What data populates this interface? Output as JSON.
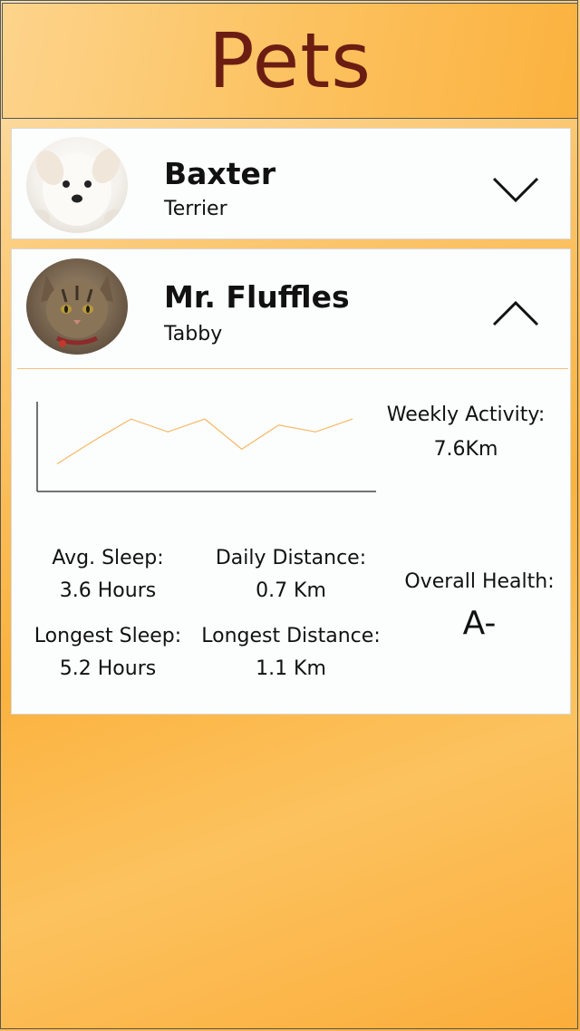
{
  "header": {
    "title": "Pets"
  },
  "pets": [
    {
      "name": "Baxter",
      "breed": "Terrier",
      "expanded": false,
      "toggle_icon": "chevron-down-icon",
      "avatar_icon": "dog-photo"
    },
    {
      "name": "Mr. Fluffles",
      "breed": "Tabby",
      "expanded": true,
      "toggle_icon": "chevron-up-icon",
      "avatar_icon": "cat-photo",
      "details": {
        "weekly_activity_label": "Weekly Activity:",
        "weekly_activity_value": "7.6Km",
        "avg_sleep_label": "Avg. Sleep:",
        "avg_sleep_value": "3.6 Hours",
        "daily_distance_label": "Daily Distance:",
        "daily_distance_value": "0.7 Km",
        "longest_sleep_label": "Longest Sleep:",
        "longest_sleep_value": "5.2 Hours",
        "longest_distance_label": "Longest Distance:",
        "longest_distance_value": "1.1 Km",
        "overall_health_label": "Overall Health:",
        "overall_health_value": "A-"
      }
    }
  ],
  "chart_data": {
    "type": "line",
    "x": [
      1,
      2,
      3,
      4,
      5,
      6,
      7,
      8,
      9
    ],
    "series": [
      {
        "values": [
          0.3,
          0.57,
          0.82,
          0.67,
          0.82,
          0.47,
          0.75,
          0.67,
          0.82
        ]
      }
    ],
    "ylim": [
      0,
      1
    ],
    "line_color": "#f6b866",
    "axis_color": "#444444"
  },
  "colors": {
    "title": "#6b1d12",
    "accent": "#fbb23e"
  }
}
